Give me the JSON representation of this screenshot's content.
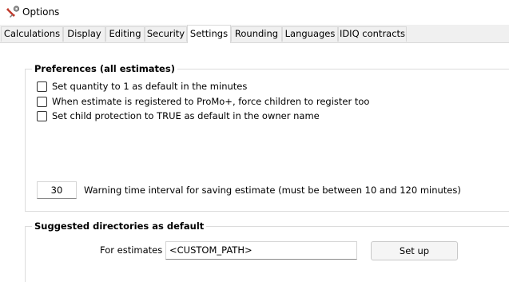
{
  "window": {
    "title": "Options",
    "icon": "options-gear-icon"
  },
  "tabs": [
    {
      "label": "Calculations",
      "active": false
    },
    {
      "label": "Display",
      "active": false
    },
    {
      "label": "Editing",
      "active": false
    },
    {
      "label": "Security",
      "active": false
    },
    {
      "label": "Settings",
      "active": true
    },
    {
      "label": "Rounding",
      "active": false
    },
    {
      "label": "Languages",
      "active": false
    },
    {
      "label": "IDIQ contracts",
      "active": false
    }
  ],
  "preferences": {
    "title": "Preferences (all estimates)",
    "options": [
      {
        "label": "Set quantity to 1 as default in the minutes",
        "checked": false
      },
      {
        "label": "When estimate is registered to ProMo+, force children to register too",
        "checked": false
      },
      {
        "label": "Set child protection to TRUE as default in the owner name",
        "checked": false
      }
    ],
    "warning_interval": {
      "value": "30",
      "label": "Warning time interval for saving estimate (must be between 10 and 120 minutes)"
    }
  },
  "directories": {
    "title": "Suggested directories as default",
    "estimates_label": "For estimates",
    "estimates_path": "<CUSTOM_PATH>",
    "setup_label": "Set up"
  }
}
